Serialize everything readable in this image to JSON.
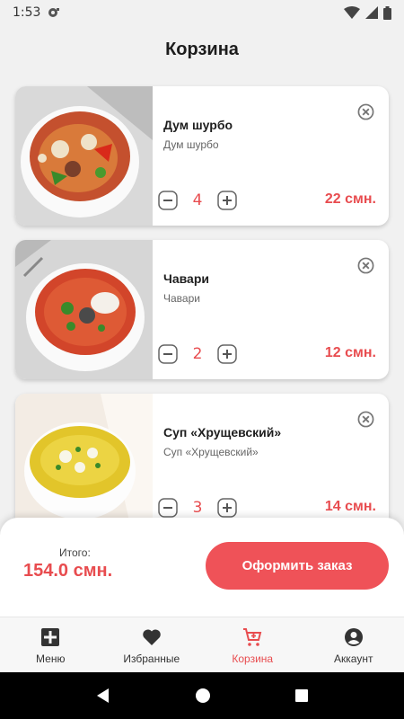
{
  "status_bar": {
    "time": "1:53"
  },
  "page": {
    "title": "Корзина"
  },
  "cart": {
    "items": [
      {
        "name": "Дум шурбо",
        "description": "Дум шурбо",
        "quantity": "4",
        "price": "22 смн."
      },
      {
        "name": "Чавари",
        "description": "Чавари",
        "quantity": "2",
        "price": "12 смн."
      },
      {
        "name": "Суп «Хрущевский»",
        "description": "Суп «Хрущевский»",
        "quantity": "3",
        "price": "14 смн."
      }
    ]
  },
  "checkout": {
    "total_label": "Итого:",
    "total_value": "154.0 смн.",
    "order_button": "Оформить заказ"
  },
  "bottom_nav": {
    "items": [
      {
        "label": "Меню",
        "icon": "menu-icon"
      },
      {
        "label": "Избранные",
        "icon": "heart-icon"
      },
      {
        "label": "Корзина",
        "icon": "cart-icon",
        "active": true
      },
      {
        "label": "Аккаунт",
        "icon": "account-icon"
      }
    ]
  },
  "colors": {
    "accent": "#e84c4f",
    "button": "#ef5258",
    "background": "#f1f1f1"
  }
}
